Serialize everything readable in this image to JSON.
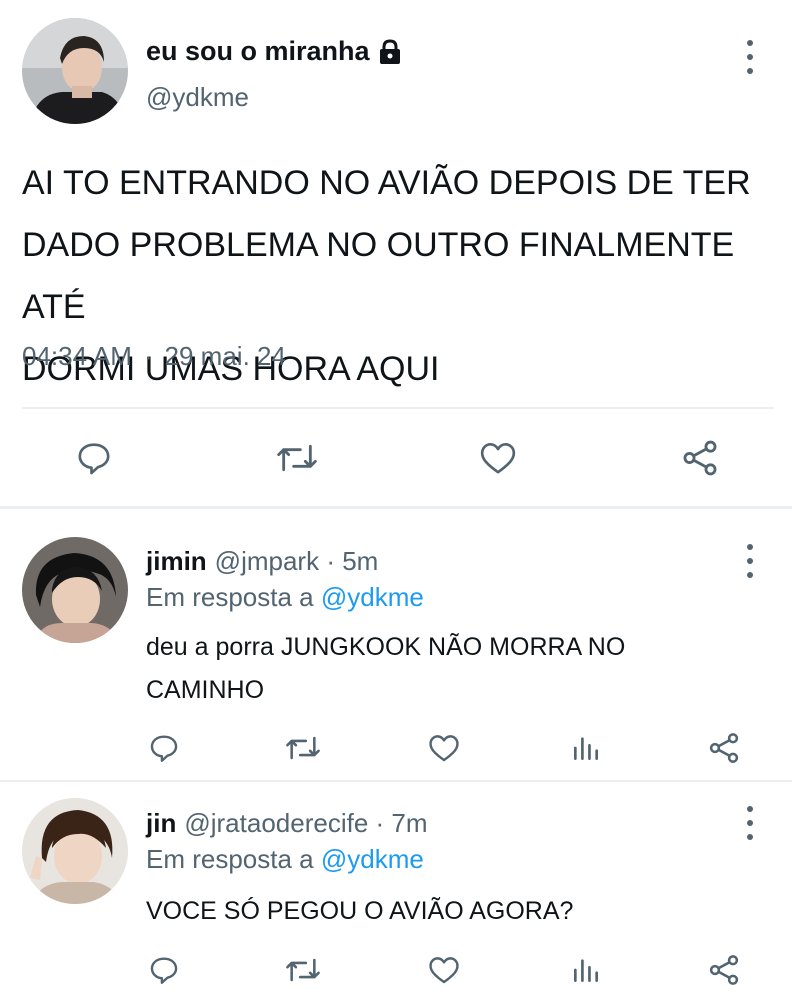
{
  "main_tweet": {
    "name": "eu sou o miranha",
    "handle": "@ydkme",
    "text_lines": [
      "AI TO ENTRANDO NO AVIÃO DEPOIS DE TER",
      "DADO PROBLEMA NO OUTRO FINALMENTE ATÉ",
      "DORMI UMAS HORA AQUI"
    ],
    "time": "04:34 AM",
    "separator": "·",
    "date": "29 mai. 24",
    "icons": [
      "lock-icon",
      "reply-icon",
      "retweet-icon",
      "like-icon",
      "share-icon",
      "more-icon"
    ]
  },
  "replies": [
    {
      "name": "jimin",
      "handle": "@jmpark",
      "separator": "·",
      "time": "5m",
      "replying_prefix": "Em resposta a",
      "replying_to": "@ydkme",
      "text_lines": [
        "deu a porra JUNGKOOK NÃO MORRA NO",
        "CAMINHO"
      ]
    },
    {
      "name": "jin",
      "handle": "@jrataoderecife",
      "separator": "·",
      "time": "7m",
      "replying_prefix": "Em resposta a",
      "replying_to": "@ydkme",
      "text_lines": [
        "VOCE SÓ PEGOU O AVIÃO AGORA?"
      ]
    }
  ],
  "colors": {
    "text": "#0f1419",
    "secondary": "#536471",
    "link": "#1d9bf0",
    "divider": "#eceff1"
  }
}
